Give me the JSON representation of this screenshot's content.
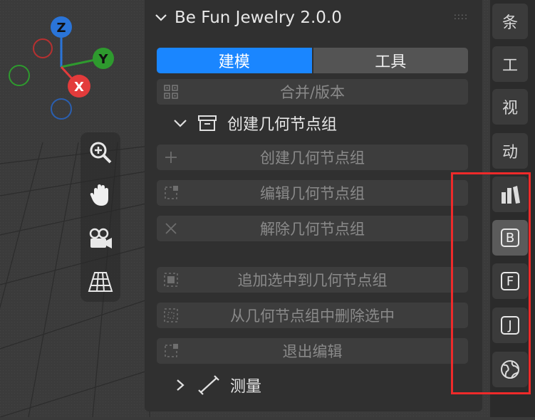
{
  "gizmo": {
    "z": "Z",
    "y": "Y",
    "x": "X"
  },
  "tools": [
    "zoom-icon",
    "hand-pan-icon",
    "camera-icon",
    "grid-perspective-icon"
  ],
  "panel": {
    "title": "Be Fun Jewelry 2.0.0",
    "tabs": [
      {
        "label": "建模",
        "active": true
      },
      {
        "label": "工具",
        "active": false
      }
    ],
    "merge_label": "合并/版本",
    "section_create": "创建几何节点组",
    "ops": {
      "create": "创建几何节点组",
      "edit": "编辑几何节点组",
      "release": "解除几何节点组",
      "add_selected": "追加选中到几何节点组",
      "remove_selected": "从几何节点组中删除选中",
      "exit_edit": "退出编辑"
    },
    "section_measure": "测量"
  },
  "right_tabs": {
    "t1": "条",
    "t2": "工",
    "t3": "视",
    "t4": "动",
    "b": "B",
    "f": "F",
    "j": "J"
  },
  "colors": {
    "accent": "#1a86ff",
    "highlight": "#ee2a2a",
    "x": "#e33b3b",
    "y": "#2e9a2e",
    "z": "#2a74d8"
  }
}
